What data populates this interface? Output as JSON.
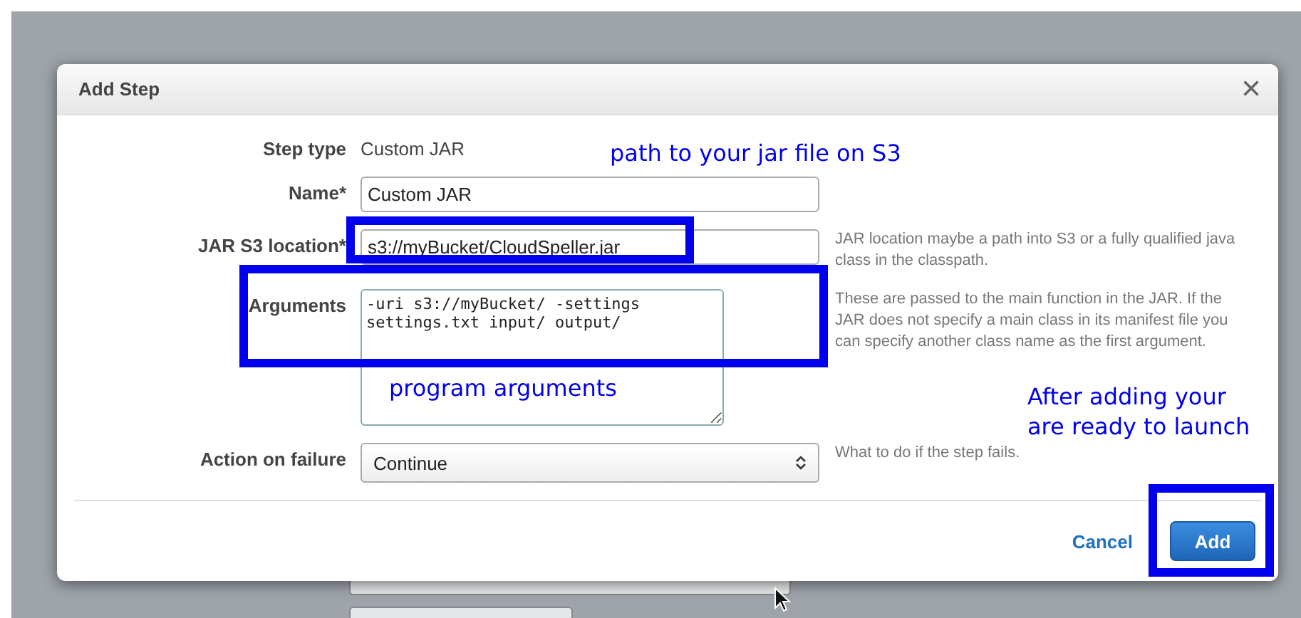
{
  "dialog": {
    "title": "Add Step",
    "close": "×",
    "fields": [
      {
        "kind": "text",
        "label": "Step type",
        "value": "Custom JAR"
      },
      {
        "kind": "input",
        "label": "Name*",
        "value": "Custom JAR"
      },
      {
        "kind": "input",
        "label": "JAR S3 location*",
        "value": "s3://myBucket/CloudSpeller.jar",
        "help": "JAR location maybe a path into S3 or a fully qualified java class in the classpath."
      },
      {
        "kind": "textarea",
        "label": "Arguments",
        "value": "-uri s3://myBucket/ -settings settings.txt input/ output/",
        "help": "These are passed to the main function in the JAR. If the JAR does not specify a main class in its manifest file you can specify another class name as the first argument."
      },
      {
        "kind": "select",
        "label": "Action on failure",
        "value": "Continue",
        "help": "What to do if the step fails."
      }
    ],
    "buttons": [
      {
        "kind": "link",
        "label": "Cancel"
      },
      {
        "kind": "primary",
        "label": "Add"
      }
    ]
  },
  "annotations": [
    "path to your jar file on S3",
    "program arguments",
    "After adding your are ready to launch"
  ]
}
